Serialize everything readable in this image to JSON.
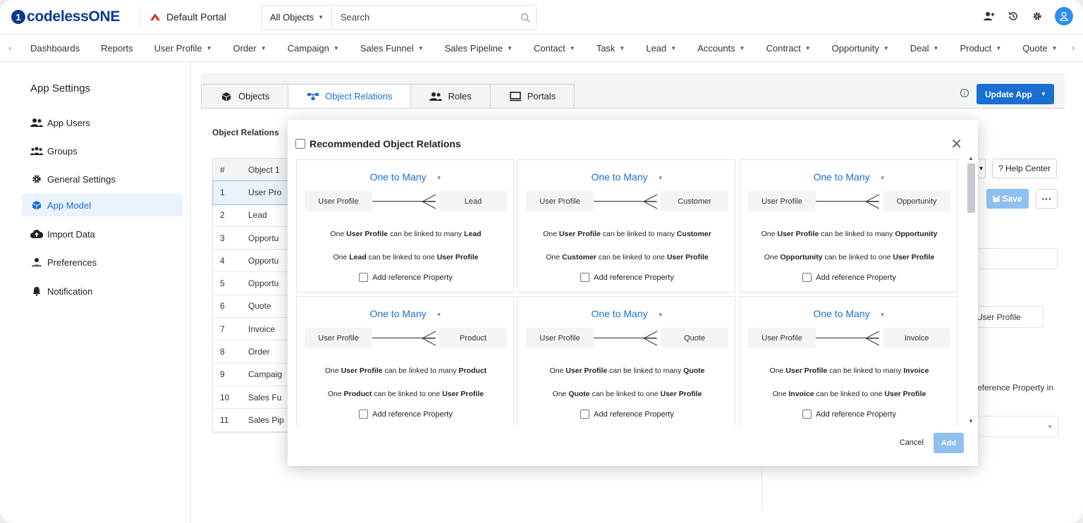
{
  "app": {
    "logo_text": "codelessONE",
    "portal_name": "Default Portal"
  },
  "search": {
    "scope": "All Objects",
    "placeholder": "Search"
  },
  "nav": {
    "items": [
      {
        "label": "Dashboards",
        "dropdown": false
      },
      {
        "label": "Reports",
        "dropdown": false
      },
      {
        "label": "User Profile",
        "dropdown": true
      },
      {
        "label": "Order",
        "dropdown": true
      },
      {
        "label": "Campaign",
        "dropdown": true
      },
      {
        "label": "Sales Funnel",
        "dropdown": true
      },
      {
        "label": "Sales Pipeline",
        "dropdown": true
      },
      {
        "label": "Contact",
        "dropdown": true
      },
      {
        "label": "Task",
        "dropdown": true
      },
      {
        "label": "Lead",
        "dropdown": true
      },
      {
        "label": "Accounts",
        "dropdown": true
      },
      {
        "label": "Contract",
        "dropdown": true
      },
      {
        "label": "Opportunity",
        "dropdown": true
      },
      {
        "label": "Deal",
        "dropdown": true
      },
      {
        "label": "Product",
        "dropdown": true
      },
      {
        "label": "Quote",
        "dropdown": true
      },
      {
        "label": "I",
        "dropdown": false
      }
    ]
  },
  "sidebar": {
    "title": "App Settings",
    "items": [
      {
        "label": "App Users",
        "icon": "users-icon",
        "active": false
      },
      {
        "label": "Groups",
        "icon": "groups-icon",
        "active": false
      },
      {
        "label": "General Settings",
        "icon": "gear-icon",
        "active": false
      },
      {
        "label": "App Model",
        "icon": "cube-icon",
        "active": true
      },
      {
        "label": "Import Data",
        "icon": "cloud-upload-icon",
        "active": false
      },
      {
        "label": "Preferences",
        "icon": "preferences-icon",
        "active": false
      },
      {
        "label": "Notification",
        "icon": "bell-icon",
        "active": false
      }
    ]
  },
  "tabs": [
    {
      "label": "Objects",
      "icon": "cube-icon",
      "active": false
    },
    {
      "label": "Object Relations",
      "icon": "relations-icon",
      "active": true
    },
    {
      "label": "Roles",
      "icon": "users-icon",
      "active": false
    },
    {
      "label": "Portals",
      "icon": "monitor-icon",
      "active": false
    }
  ],
  "toolbar": {
    "update_label": "Update App",
    "help_label": "? Help Center",
    "save_label": "Save"
  },
  "object_relations": {
    "label": "Object Relations",
    "columns": [
      "#",
      "Object 1"
    ],
    "rows": [
      {
        "num": "1",
        "name": "User Pro"
      },
      {
        "num": "2",
        "name": "Lead"
      },
      {
        "num": "3",
        "name": "Opportu"
      },
      {
        "num": "4",
        "name": "Opportu"
      },
      {
        "num": "5",
        "name": "Opportu"
      },
      {
        "num": "6",
        "name": "Quote"
      },
      {
        "num": "7",
        "name": "Invoice"
      },
      {
        "num": "8",
        "name": "Order"
      },
      {
        "num": "9",
        "name": "Campaig"
      },
      {
        "num": "10",
        "name": "Sales Fu"
      },
      {
        "num": "11",
        "name": "Sales Pip"
      }
    ]
  },
  "right_pane": {
    "user_profile_text": "User Profile",
    "reference_text": "eference Property in"
  },
  "modal": {
    "title": "Recommended Object Relations",
    "cancel_label": "Cancel",
    "add_label": "Add",
    "cards": [
      {
        "type": "One to Many",
        "left": "User Profile",
        "right": "Lead",
        "line1_a": "One ",
        "line1_b": "User Profile",
        "line1_c": " can be linked to many ",
        "line1_d": "Lead",
        "line2_a": "One ",
        "line2_b": "Lead",
        "line2_c": " can be linked to one ",
        "line2_d": "User Profile",
        "ref_label": "Add reference Property"
      },
      {
        "type": "One to Many",
        "left": "User Profile",
        "right": "Customer",
        "line1_a": "One ",
        "line1_b": "User Profile",
        "line1_c": " can be linked to many ",
        "line1_d": "Customer",
        "line2_a": "One ",
        "line2_b": "Customer",
        "line2_c": " can be linked to one ",
        "line2_d": "User Profile",
        "ref_label": "Add reference Property"
      },
      {
        "type": "One to Many",
        "left": "User Profile",
        "right": "Opportunity",
        "line1_a": "One ",
        "line1_b": "User Profile",
        "line1_c": " can be linked to many ",
        "line1_d": "Opportunity",
        "line2_a": "One ",
        "line2_b": "Opportunity",
        "line2_c": " can be linked to one ",
        "line2_d": "User Profile",
        "ref_label": "Add reference Property"
      },
      {
        "type": "One to Many",
        "left": "User Profile",
        "right": "Product",
        "line1_a": "One ",
        "line1_b": "User Profile",
        "line1_c": " can be linked to many ",
        "line1_d": "Product",
        "line2_a": "One ",
        "line2_b": "Product",
        "line2_c": " can be linked to one ",
        "line2_d": "User Profile",
        "ref_label": "Add reference Property"
      },
      {
        "type": "One to Many",
        "left": "User Profile",
        "right": "Quote",
        "line1_a": "One ",
        "line1_b": "User Profile",
        "line1_c": " can be linked to many ",
        "line1_d": "Quote",
        "line2_a": "One ",
        "line2_b": "Quote",
        "line2_c": " can be linked to one ",
        "line2_d": "User Profile",
        "ref_label": "Add reference Property"
      },
      {
        "type": "One to Many",
        "left": "User Profile",
        "right": "Invoice",
        "line1_a": "One ",
        "line1_b": "User Profile",
        "line1_c": " can be linked to many ",
        "line1_d": "Invoice",
        "line2_a": "One ",
        "line2_b": "Invoice",
        "line2_c": " can be linked to one ",
        "line2_d": "User Profile",
        "ref_label": "Add reference Property"
      }
    ]
  },
  "colors": {
    "accent": "#1a6fd1",
    "brand": "#0d3b8c",
    "disabled": "#8fc0ef"
  }
}
